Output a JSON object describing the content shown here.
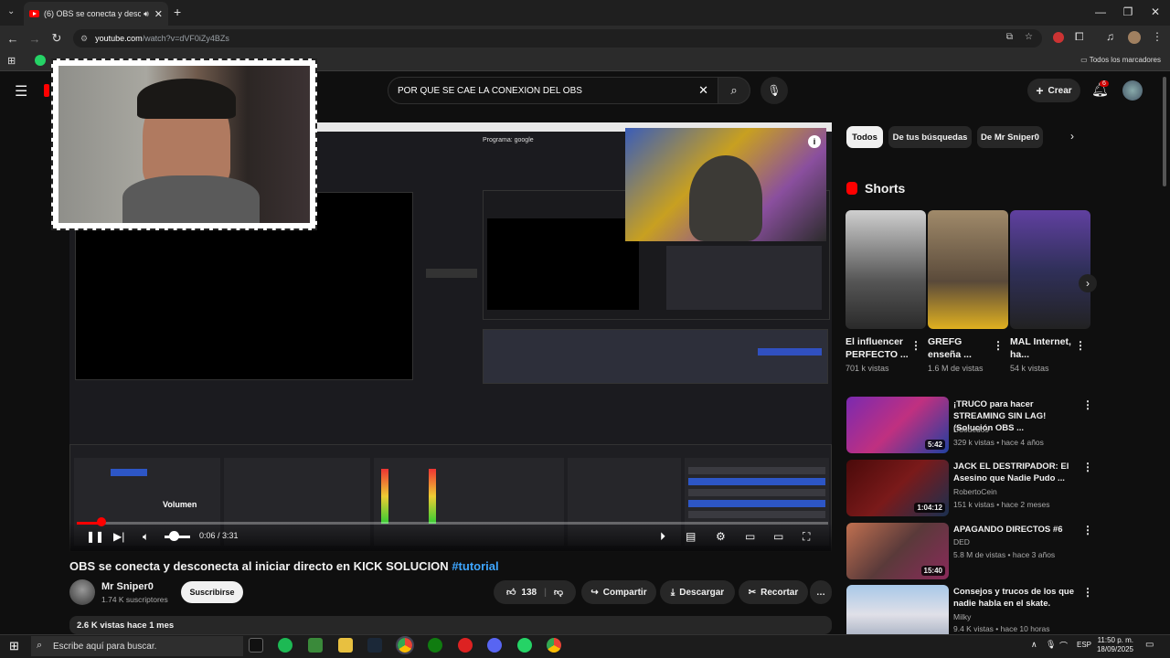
{
  "browser": {
    "tab_title": "(6) OBS se conecta y desco",
    "url_host": "youtube.com",
    "url_path": "/watch?v=dVF0iZy4BZs",
    "bookmarks_label": "Todos los marcadores"
  },
  "youtube": {
    "search_query": "POR QUE SE CAE LA CONEXION DEL OBS",
    "create_label": "Crear",
    "notifications_count": "6"
  },
  "video": {
    "obs_program_label": "Programa: google",
    "volume_tooltip": "Volumen",
    "time": "0:06 / 3:31",
    "progress": 0.03,
    "title": "OBS se conecta y desconecta al iniciar directo en KICK SOLUCION",
    "hashtag": "#tutorial",
    "channel": "Mr Sniper0",
    "subscribers": "1.74 K suscriptores",
    "subscribe_label": "Suscribirse",
    "likes": "138",
    "share_label": "Compartir",
    "download_label": "Descargar",
    "clip_label": "Recortar",
    "description_meta": "2.6 K vistas  hace 1 mes"
  },
  "sidebar": {
    "chips": [
      "Todos",
      "De tus búsquedas",
      "De Mr Sniper0"
    ],
    "shorts_heading": "Shorts",
    "shorts": [
      {
        "title": "El influencer PERFECTO ...",
        "views": "701 k vistas"
      },
      {
        "title": "GREFG enseña ...",
        "views": "1.6 M de vistas"
      },
      {
        "title": "MAL Internet, ha...",
        "views": "54 k vistas"
      }
    ],
    "recommended": [
      {
        "title": "¡TRUCO para hacer STREAMING SIN LAG! (Solución OBS ...",
        "channel": "Duodedos",
        "meta": "329 k vistas • hace 4 años",
        "duration": "5:42"
      },
      {
        "title": "JACK EL DESTRIPADOR: El Asesino que Nadie Pudo ...",
        "channel": "RobertoCein",
        "meta": "151 k vistas • hace 2 meses",
        "duration": "1:04:12"
      },
      {
        "title": "APAGANDO DIRECTOS #6",
        "channel": "DED",
        "meta": "5.8 M de vistas • hace 3 años",
        "duration": "15:40"
      },
      {
        "title": "Consejos y trucos de los que nadie habla en el skate.",
        "channel": "Milky",
        "meta": "9.4 K vistas • hace 10 horas",
        "duration": ""
      }
    ]
  },
  "taskbar": {
    "search_placeholder": "Escribe aquí para buscar.",
    "language": "ESP",
    "time": "11:50 p. m.",
    "date": "18/09/2025"
  },
  "colors": {
    "accent": "#ff0000",
    "link": "#3ea6ff",
    "background": "#0f0f0f"
  }
}
